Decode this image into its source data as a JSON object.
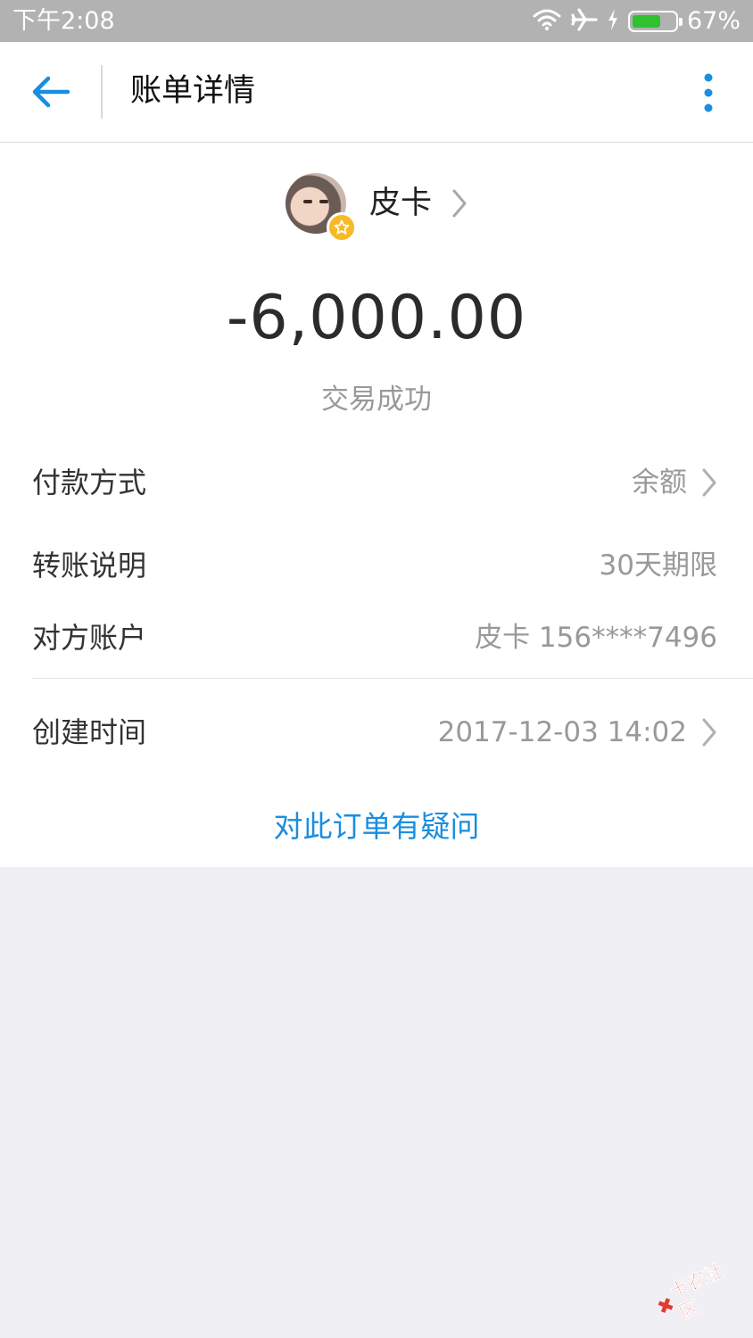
{
  "status_bar": {
    "time": "下午2:08",
    "battery_percent": "67%",
    "battery_level": 0.67,
    "icons": [
      "wifi-icon",
      "airplane-icon",
      "charging-icon",
      "battery-icon"
    ]
  },
  "header": {
    "title": "账单详情",
    "back_icon": "back-arrow-icon",
    "more_icon": "more-vertical-icon"
  },
  "payee": {
    "name": "皮卡",
    "badge_icon": "star-badge-icon"
  },
  "transaction": {
    "amount": "-6,000.00",
    "status": "交易成功"
  },
  "details": [
    {
      "label": "付款方式",
      "value": "余额",
      "has_chevron": true
    },
    {
      "label": "转账说明",
      "value": "30天期限",
      "has_chevron": false
    },
    {
      "label": "对方账户",
      "value": "皮卡 156****7496",
      "has_chevron": false
    },
    {
      "label": "创建时间",
      "value": "2017-12-03 14:02",
      "has_chevron": true
    }
  ],
  "question_link": "对此订单有疑问",
  "watermark": "卡农社区",
  "colors": {
    "accent": "#1a8ee0",
    "status_bar": "#b2b2b2",
    "page_background": "#efeff4",
    "battery": "#2fc12f",
    "badge": "#f7b925",
    "watermark": "#e23a2f"
  }
}
